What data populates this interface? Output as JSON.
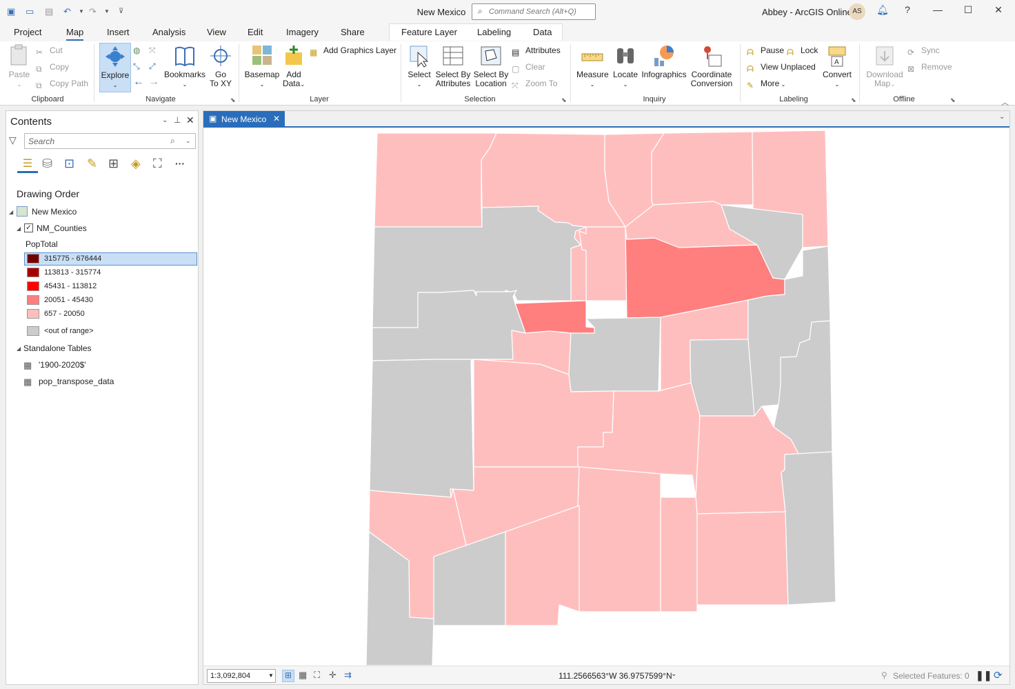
{
  "window": {
    "title": "New Mexico",
    "command_search_placeholder": "Command Search (Alt+Q)",
    "user": "Abbey - ArcGIS Online",
    "avatar": "AS"
  },
  "tabs": [
    "Project",
    "Map",
    "Insert",
    "Analysis",
    "View",
    "Edit",
    "Imagery",
    "Share"
  ],
  "context_tabs": [
    "Feature Layer",
    "Labeling",
    "Data"
  ],
  "ribbon": {
    "clipboard": {
      "group": "Clipboard",
      "paste": "Paste",
      "cut": "Cut",
      "copy": "Copy",
      "copy_path": "Copy Path"
    },
    "navigate": {
      "group": "Navigate",
      "explore": "Explore",
      "bookmarks": "Bookmarks",
      "go_to_xy_1": "Go",
      "go_to_xy_2": "To XY"
    },
    "layer": {
      "group": "Layer",
      "basemap": "Basemap",
      "add_data_1": "Add",
      "add_data_2": "Data",
      "add_graphics_layer": "Add Graphics Layer"
    },
    "selection": {
      "group": "Selection",
      "select": "Select",
      "select_by_attr_1": "Select By",
      "select_by_attr_2": "Attributes",
      "select_by_loc_1": "Select By",
      "select_by_loc_2": "Location",
      "attributes": "Attributes",
      "clear": "Clear",
      "zoom_to": "Zoom To"
    },
    "inquiry": {
      "group": "Inquiry",
      "measure": "Measure",
      "locate": "Locate",
      "infographics": "Infographics",
      "coord_1": "Coordinate",
      "coord_2": "Conversion"
    },
    "labeling": {
      "group": "Labeling",
      "pause": "Pause",
      "lock": "Lock",
      "view_unplaced": "View Unplaced",
      "more": "More",
      "convert": "Convert"
    },
    "offline": {
      "group": "Offline",
      "download_1": "Download",
      "download_2": "Map",
      "sync": "Sync",
      "remove": "Remove"
    }
  },
  "contents": {
    "title": "Contents",
    "search_placeholder": "Search",
    "drawing_order": "Drawing Order",
    "map_name": "New Mexico",
    "layer_name": "NM_Counties",
    "field": "PopTotal",
    "legend": [
      {
        "label": "315775 - 676444",
        "color": "#730000"
      },
      {
        "label": "113813 - 315774",
        "color": "#a80000"
      },
      {
        "label": "45431 - 113812",
        "color": "#ff0000"
      },
      {
        "label": "20051 - 45430",
        "color": "#ff7f7f"
      },
      {
        "label": "657 - 20050",
        "color": "#ffbebe"
      },
      {
        "label": "<out of range>",
        "color": "#cccccc"
      }
    ],
    "standalone_tables": "Standalone Tables",
    "tables": [
      "'1900-2020$'",
      "pop_transpose_data"
    ]
  },
  "map": {
    "tab_title": "New Mexico",
    "scale": "1:3,092,804",
    "coordinates": "111.2566563°W 36.9757599°N",
    "selected_features": "Selected Features: 0"
  },
  "colors": {
    "accent": "#2a6ebb",
    "light": "#ffbebe",
    "mid": "#ff7f7f",
    "gray": "#cccccc"
  }
}
